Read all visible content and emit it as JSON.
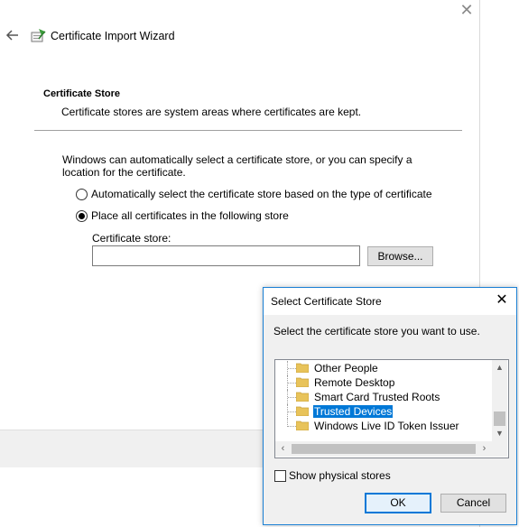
{
  "wizard": {
    "title": "Certificate Import Wizard",
    "section_title": "Certificate Store",
    "section_description": "Certificate stores are system areas where certificates are kept.",
    "intro_text": "Windows can automatically select a certificate store, or you can specify a location for the certificate.",
    "options": [
      {
        "label": "Automatically select the certificate store based on the type of certificate",
        "selected": false
      },
      {
        "label": "Place all certificates in the following store",
        "selected": true
      }
    ],
    "store_label": "Certificate store:",
    "store_value": "",
    "browse_label": "Browse..."
  },
  "dialog": {
    "title": "Select Certificate Store",
    "instruction": "Select the certificate store you want to use.",
    "tree_items": [
      {
        "label": "Other People",
        "selected": false
      },
      {
        "label": "Remote Desktop",
        "selected": false
      },
      {
        "label": "Smart Card Trusted Roots",
        "selected": false
      },
      {
        "label": "Trusted Devices",
        "selected": true
      },
      {
        "label": "Windows Live ID Token Issuer",
        "selected": false
      }
    ],
    "show_physical_label": "Show physical stores",
    "show_physical_checked": false,
    "ok_label": "OK",
    "cancel_label": "Cancel"
  },
  "colors": {
    "accent": "#0078d7",
    "folder": "#e8c35a"
  },
  "icons": [
    "back-arrow-icon",
    "certificate-wizard-icon",
    "close-icon",
    "folder-icon",
    "scroll-up-icon",
    "scroll-down-icon",
    "scroll-left-icon",
    "scroll-right-icon"
  ]
}
